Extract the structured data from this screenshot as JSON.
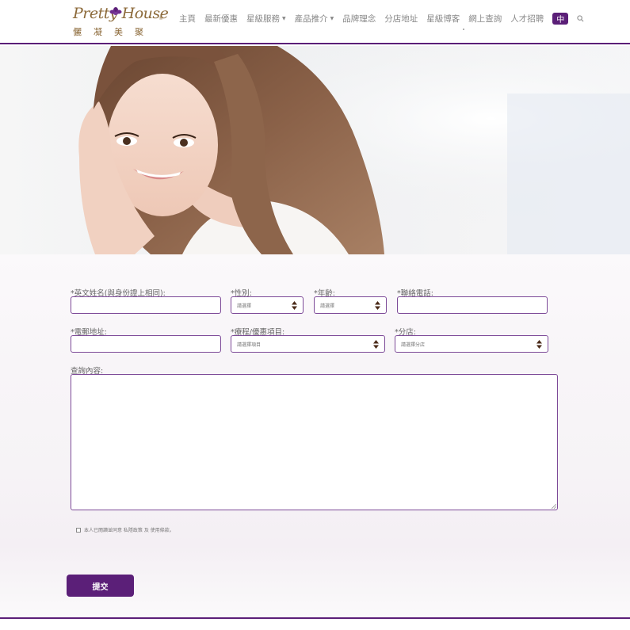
{
  "brand": {
    "logo_script": "Pretty House",
    "logo_cn": "儷凝美聚",
    "logo_reg": "®"
  },
  "nav": {
    "items": [
      {
        "label": "主頁",
        "dropdown": false
      },
      {
        "label": "最新優惠",
        "dropdown": false
      },
      {
        "label": "星級服務",
        "dropdown": true
      },
      {
        "label": "產品推介",
        "dropdown": true
      },
      {
        "label": "品牌理念",
        "dropdown": false
      },
      {
        "label": "分店地址",
        "dropdown": false
      },
      {
        "label": "星級博客",
        "dropdown": false
      },
      {
        "label": "網上查詢",
        "dropdown": false
      },
      {
        "label": "人才招聘",
        "dropdown": false
      }
    ],
    "lang": "中",
    "search_icon": "search-icon"
  },
  "form": {
    "name_label": "*英文姓名(與身份證上相同):",
    "gender_label": "*性別:",
    "gender_placeholder": "請選擇",
    "age_label": "*年齡:",
    "age_placeholder": "請選擇",
    "phone_label": "*聯絡電話:",
    "email_label": "*電郵地址:",
    "course_label": "*療程/優惠項目:",
    "course_placeholder": "請選擇項目",
    "branch_label": "*分店:",
    "branch_placeholder": "請選擇分店",
    "message_label": "查詢內容:",
    "consent_text": "本人已閱讀並同意 私隱政策 及 使用條款。",
    "submit_label": "提交"
  },
  "colors": {
    "accent": "#5b1f78",
    "border": "#7d4a98",
    "logo_gold": "#8c6a3a"
  }
}
